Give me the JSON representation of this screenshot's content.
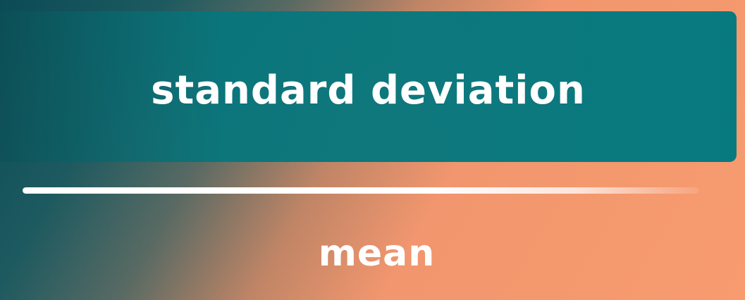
{
  "fraction": {
    "numerator": "standard deviation",
    "denominator": "mean"
  },
  "colors": {
    "box": "#077a80",
    "background_dark": "#0b4b56",
    "background_light": "#f89b6f",
    "text": "#ffffff"
  }
}
